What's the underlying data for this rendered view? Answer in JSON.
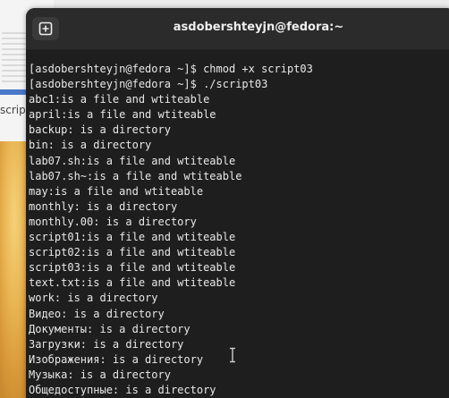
{
  "background_window": {
    "partial_text": "scrip",
    "partial_label": "ajeia"
  },
  "terminal": {
    "title": "asdobershteyjn@fedora:~",
    "new_tab_icon": "plus-square-icon",
    "lines": [
      "[asdobershteyjn@fedora ~]$ chmod +x script03",
      "[asdobershteyjn@fedora ~]$ ./script03",
      "abc1:is a file and wtiteable",
      "april:is a file and wtiteable",
      "backup: is a directory",
      "bin: is a directory",
      "lab07.sh:is a file and wtiteable",
      "lab07.sh~:is a file and wtiteable",
      "may:is a file and wtiteable",
      "monthly: is a directory",
      "monthly.00: is a directory",
      "script01:is a file and wtiteable",
      "script02:is a file and wtiteable",
      "script03:is a file and wtiteable",
      "text.txt:is a file and wtiteable",
      "work: is a directory",
      "Видео: is a directory",
      "Документы: is a directory",
      "Загрузки: is a directory",
      "Изображения: is a directory",
      "Музыка: is a directory",
      "Общедоступные: is a directory"
    ]
  },
  "colors": {
    "terminal_bg": "#1e1e1e",
    "titlebar_bg": "#2b2b2b",
    "text": "#e8e8e8"
  }
}
